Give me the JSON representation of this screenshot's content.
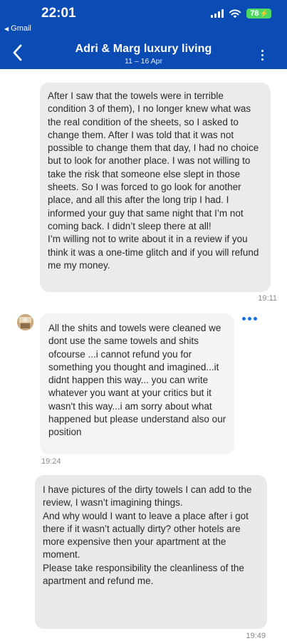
{
  "status_bar": {
    "time": "22:01",
    "back_app": "Gmail",
    "battery": "78"
  },
  "header": {
    "title": "Adri & Marg luxury living",
    "subtitle": "11 – 16 Apr"
  },
  "messages": [
    {
      "sender": "guest",
      "text": "After I saw that the towels were in terrible condition 3 of them), I no longer knew what was the real condition of the sheets, so I asked to change them. After I was told that it was not possible to change them that day, I had no choice but to look for another place. I was not willing to take the risk that someone else slept in those sheets. So I was forced to go look for another place, and all this after the long trip I had. I informed your guy that same night that I’m not coming back. I didn’t sleep there at all!\nI’m willing not to write about it in a review if you think it was a one-time glitch and if you will refund me my money.",
      "time": "19:11"
    },
    {
      "sender": "host",
      "text": "All the shits and towels were cleaned we dont use the same towels and shits ofcourse ...i cannot refund you for something you thought and imagined...it didnt happen this way... you can write whatever you want at your critics but it wasn't this way...i am sorry about what happened but please understand also our position",
      "time": "19:24"
    },
    {
      "sender": "guest",
      "text": "I have pictures of the dirty towels I can add to the review, I wasn’t imagining things.\nAnd why would I want to leave a place after i got there if it wasn’t actually dirty? other hotels are more expensive then your apartment at the moment.\nPlease take responsibility the cleanliness of the apartment and refund me.",
      "time": "19:49"
    }
  ],
  "colors": {
    "brand": "#0a4cb3",
    "guest_bubble": "#ebebeb",
    "host_bubble": "#f4f4f4",
    "accent_dots": "#1a6fe0",
    "battery": "#4cd964"
  },
  "icons": {
    "back": "chevron-left-icon",
    "menu": "more-vertical-icon",
    "message_menu": "more-horizontal-icon",
    "signal": "cellular-signal-icon",
    "wifi": "wifi-icon",
    "battery": "battery-charging-icon"
  }
}
